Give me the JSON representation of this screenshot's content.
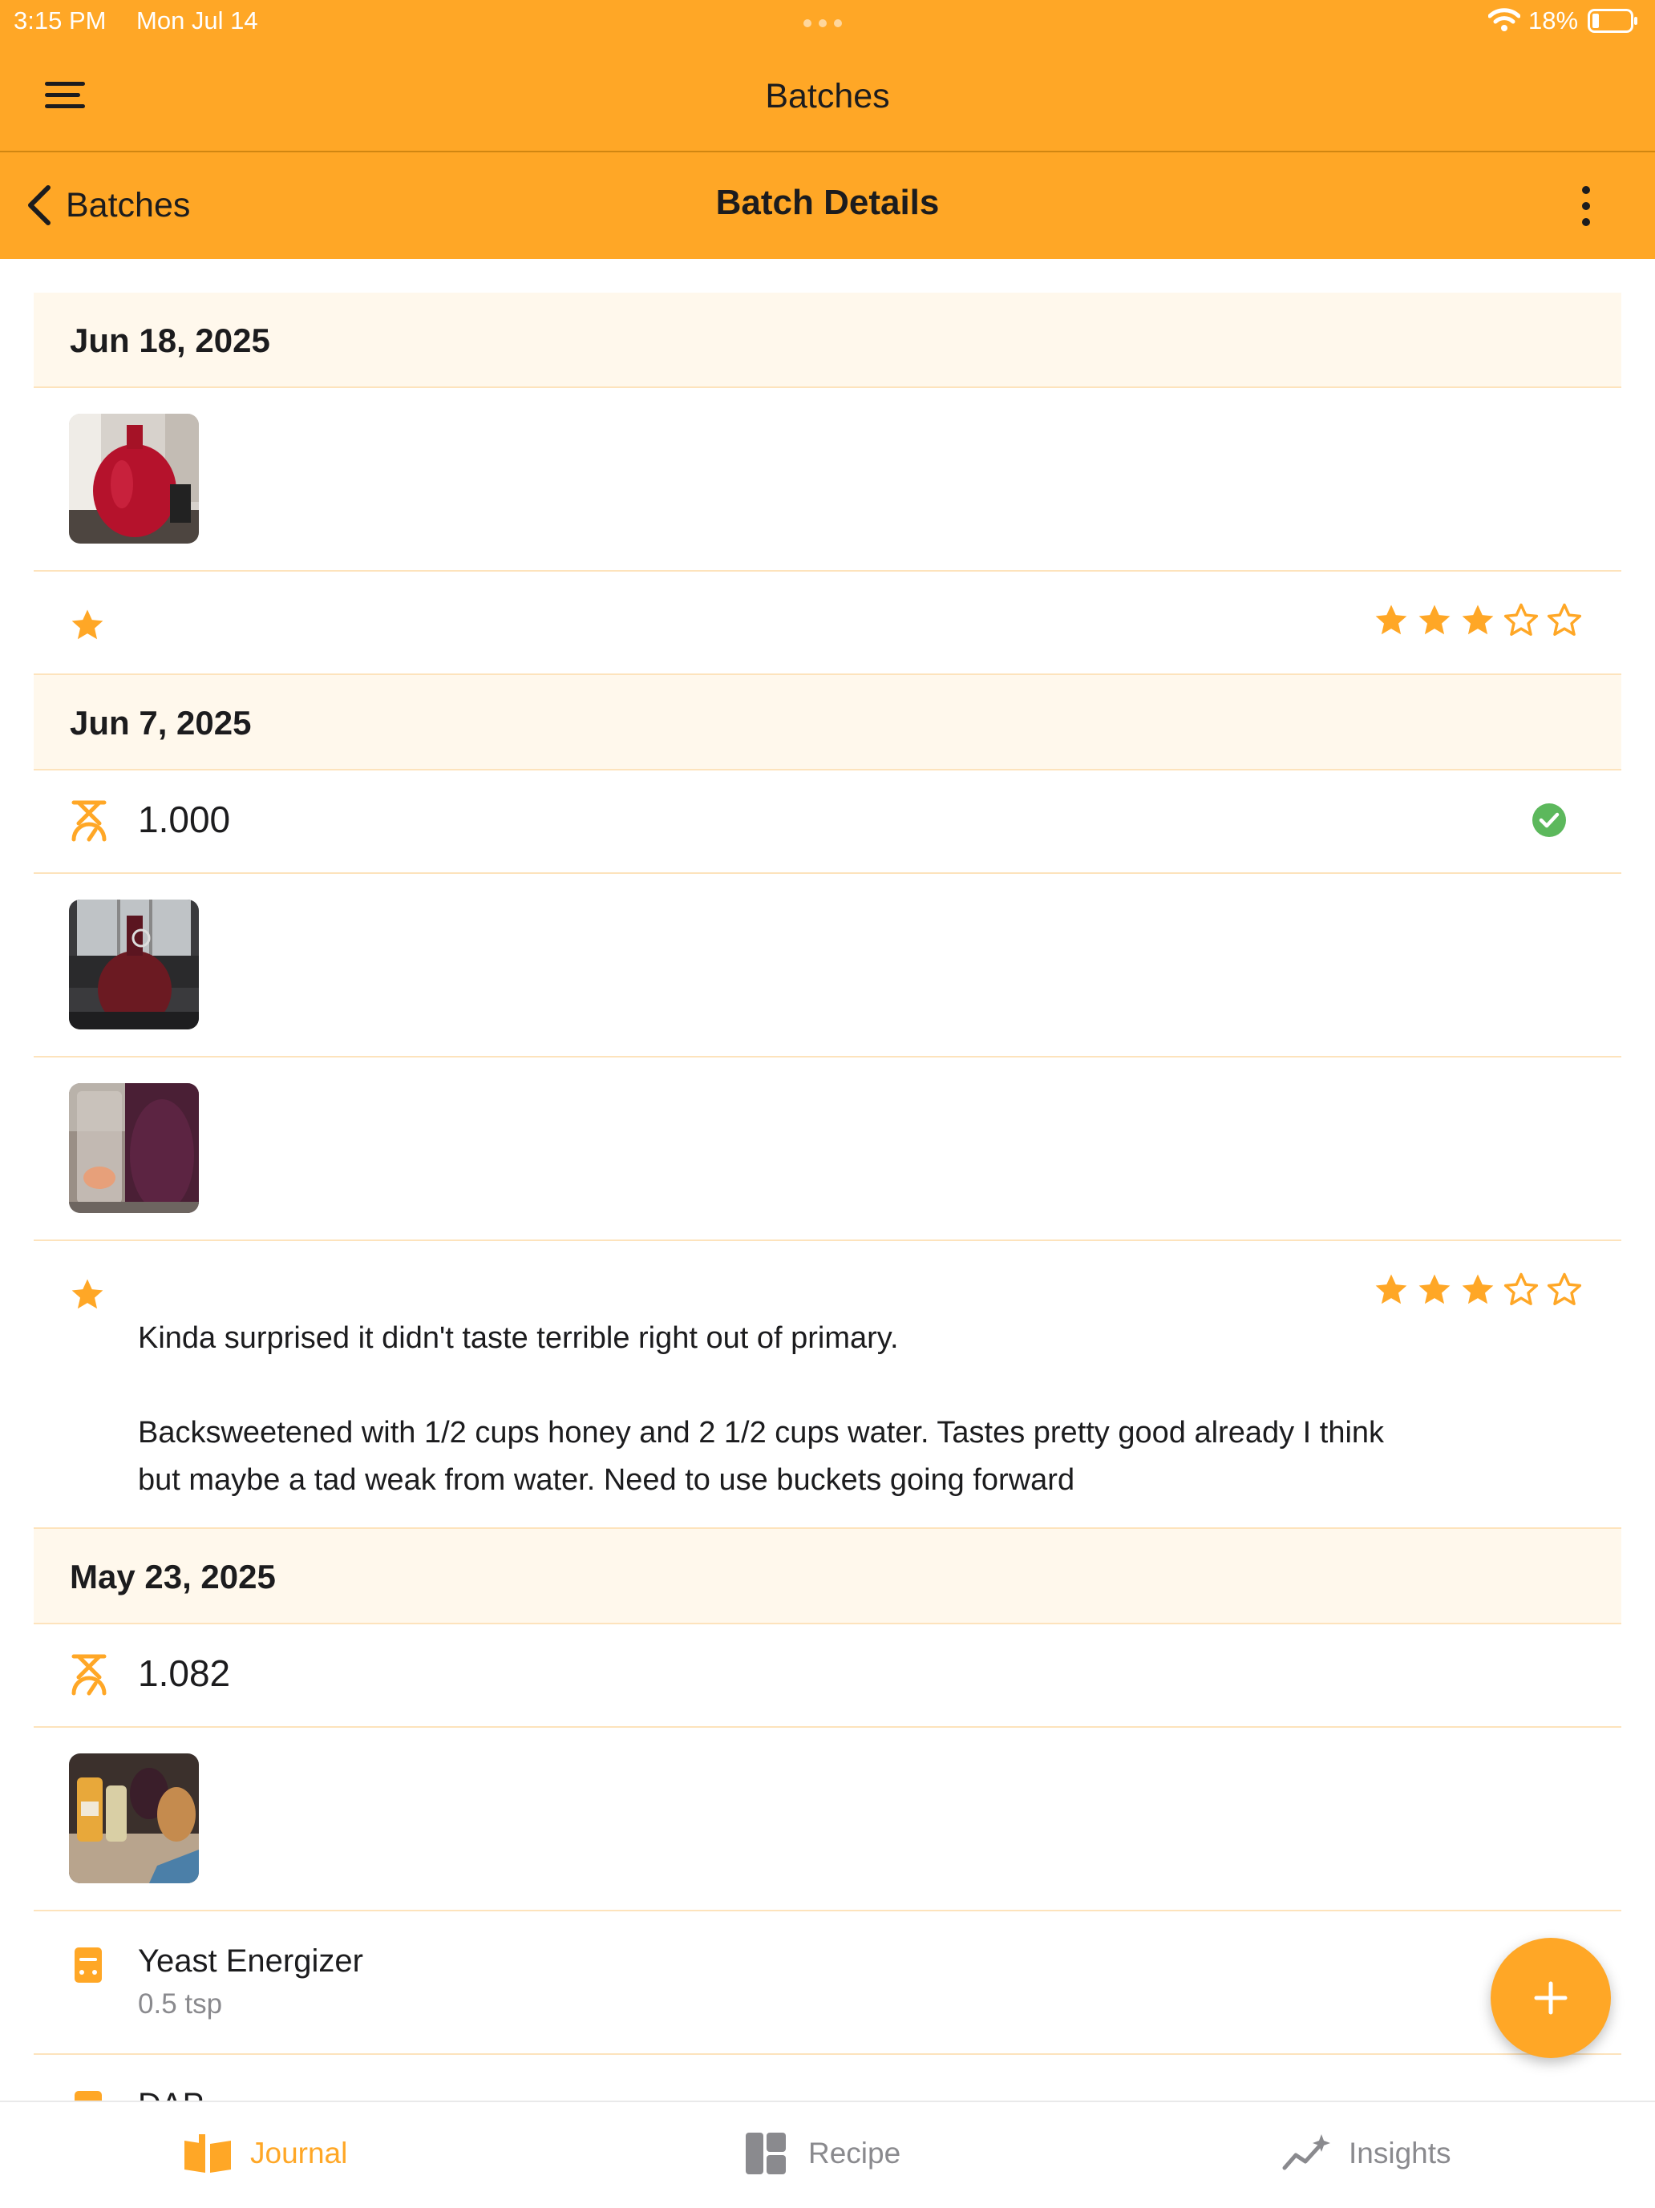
{
  "status_bar": {
    "time": "3:15 PM",
    "date": "Mon Jul 14",
    "battery_pct": "18%"
  },
  "app_bar": {
    "title": "Batches"
  },
  "nav_bar": {
    "back_label": "Batches",
    "title": "Batch Details"
  },
  "colors": {
    "accent": "#ffa726",
    "section_bg": "#fff8ec",
    "divider": "#fde3bc",
    "success": "#5cb85c",
    "muted": "#8a8a8e"
  },
  "icons": {
    "menu": "menu-icon",
    "back": "chevron-left-icon",
    "more": "more-vertical-icon",
    "rating_marker": "star-icon",
    "gravity": "hydrometer-icon",
    "verified": "check-circle-icon",
    "ingredient": "ingredient-icon",
    "add": "plus-icon",
    "journal": "book-icon",
    "recipe": "layout-icon",
    "insights": "sparkline-icon"
  },
  "entries": [
    {
      "date": "Jun 18, 2025",
      "photos": [
        "Red mead in glass carboy"
      ],
      "rating": {
        "value": 3,
        "max": 5
      }
    },
    {
      "date": "Jun 7, 2025",
      "gravity": {
        "value": "1.000",
        "verified": true
      },
      "photos": [
        "Carboy against window",
        "Glass next to jug"
      ],
      "rating": {
        "value": 3,
        "max": 5
      },
      "note_lines": [
        "Kinda surprised it didn't taste terrible right out of primary.",
        "Backsweetened with 1/2 cups honey and 2 1/2 cups water. Tastes pretty good already I think",
        "but maybe a tad weak from water. Need to use buckets going forward"
      ]
    },
    {
      "date": "May 23, 2025",
      "gravity": {
        "value": "1.082"
      },
      "photos": [
        "Juice bottles and jugs on counter"
      ],
      "ingredients": [
        {
          "name": "Yeast Energizer",
          "amount": "0.5 tsp"
        },
        {
          "name": "DAP",
          "amount": ""
        }
      ]
    }
  ],
  "tabs": [
    {
      "label": "Journal",
      "active": true
    },
    {
      "label": "Recipe",
      "active": false
    },
    {
      "label": "Insights",
      "active": false
    }
  ]
}
